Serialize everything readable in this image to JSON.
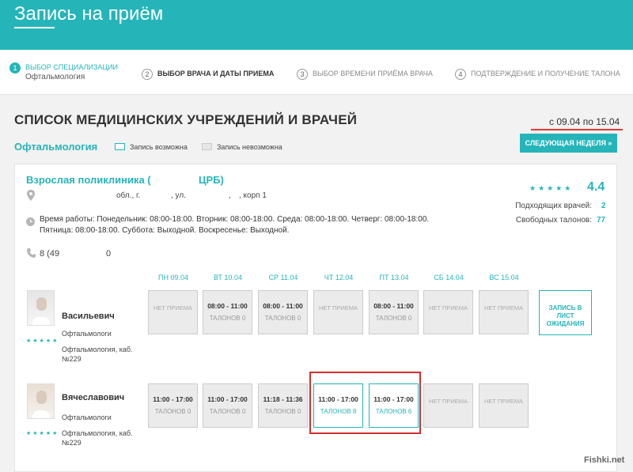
{
  "header": {
    "title": "Запись на приём"
  },
  "steps": [
    {
      "num": "1",
      "label": "ВЫБОР СПЕЦИАЛИЗАЦИИ",
      "sub": "Офтальмология"
    },
    {
      "num": "2",
      "label": "ВЫБОР ВРАЧА И ДАТЫ ПРИЕМА"
    },
    {
      "num": "3",
      "label": "ВЫБОР ВРЕМЕНИ ПРИЁМА ВРАЧА"
    },
    {
      "num": "4",
      "label": "ПОДТВЕРЖДЕНИЕ И ПОЛУЧЕНИЕ ТАЛОНА"
    }
  ],
  "page_title": "СПИСОК МЕДИЦИНСКИХ УЧРЕЖДЕНИЙ И ВРАЧЕЙ",
  "date_range": "с 09.04 по 15.04",
  "specialization": "Офтальмология",
  "legend": {
    "available": "Запись возможна",
    "unavailable": "Запись невозможна"
  },
  "next_week_button": "СЛЕДУЮЩАЯ НЕДЕЛЯ »",
  "clinic": {
    "name_part1": "Взрослая поликлиника (",
    "name_part2": "ЦРБ)",
    "addr_region": "обл., г.",
    "addr_street": ", ул.",
    "addr_comma": ",",
    "addr_building": ", корп 1",
    "hours_line1": "Время работы: Понедельник: 08:00-18:00. Вторник: 08:00-18:00. Среда: 08:00-18:00. Четверг: 08:00-18:00.",
    "hours_line2": "Пятница: 08:00-18:00. Суббота: Выходной. Воскресенье: Выходной.",
    "phone_start": "8 (49",
    "phone_end": "0",
    "rating_stars": "★★★★★",
    "rating": "4.4",
    "doctors_label": "Подходящих врачей:",
    "doctors_count": "2",
    "tickets_label": "Свободных талонов:",
    "tickets_count": "77"
  },
  "days": [
    "ПН 09.04",
    "ВТ 10.04",
    "СР 11.04",
    "ЧТ 12.04",
    "ПТ 13.04",
    "СБ 14.04",
    "ВС 15.04"
  ],
  "doctors": [
    {
      "name": "Васильевич",
      "spec": "Офтальмологи",
      "cabinet": "Офтальмология, каб. №229",
      "stars": "★★★★★",
      "slots": [
        {
          "none": "НЕТ ПРИЕМА"
        },
        {
          "time": "08:00 - 11:00",
          "count": "ТАЛОНОВ 0"
        },
        {
          "time": "08:00 - 11:00",
          "count": "ТАЛОНОВ 0"
        },
        {
          "none": "НЕТ ПРИЕМА"
        },
        {
          "time": "08:00 - 11:00",
          "count": "ТАЛОНОВ 0"
        },
        {
          "none": "НЕТ ПРИЕМА"
        },
        {
          "none": "НЕТ ПРИЕМА"
        }
      ],
      "waitlist": "ЗАПИСЬ В ЛИСТ ОЖИДАНИЯ"
    },
    {
      "name": "Вячеславович",
      "spec": "Офтальмологи",
      "cabinet": "Офтальмология, каб. №229",
      "stars": "★★★★★",
      "slots": [
        {
          "time": "11:00 - 17:00",
          "count": "ТАЛОНОВ 0"
        },
        {
          "time": "11:00 - 17:00",
          "count": "ТАЛОНОВ 0"
        },
        {
          "time": "11:18 - 11:36",
          "count": "ТАЛОНОВ 0"
        },
        {
          "time": "11:00 - 17:00",
          "count": "ТАЛОНОВ 8"
        },
        {
          "time": "11:00 - 17:00",
          "count": "ТАЛОНОВ 6"
        },
        {
          "none": "НЕТ ПРИЕМА"
        },
        {
          "none": "НЕТ ПРИЕМА"
        }
      ]
    }
  ],
  "watermark": "Fishki.net",
  "colors": {
    "accent": "#25b5b9",
    "highlight": "#d32f2f",
    "underline": "#e53935"
  }
}
